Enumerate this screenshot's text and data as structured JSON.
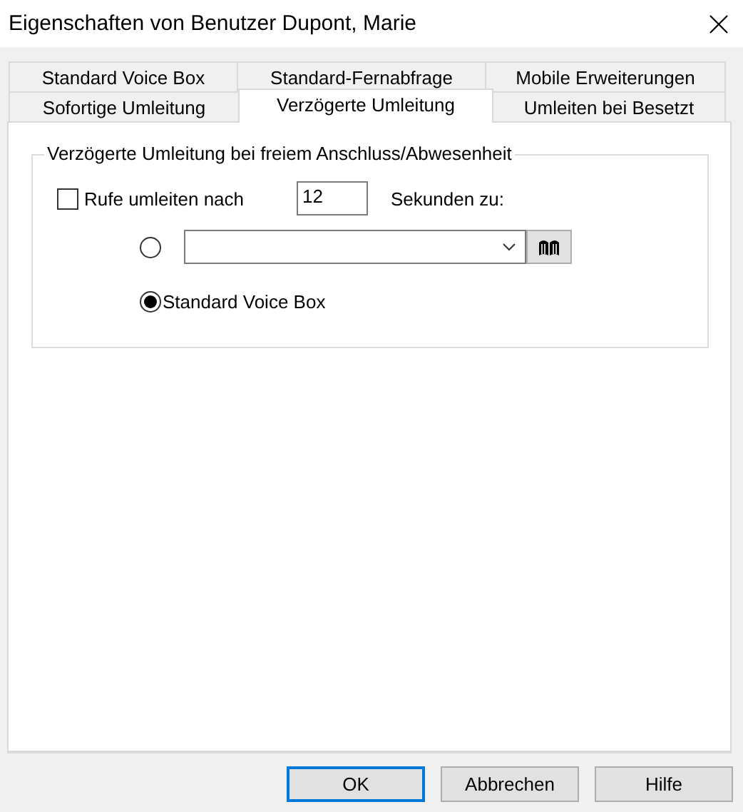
{
  "window": {
    "title": "Eigenschaften von Benutzer Dupont, Marie"
  },
  "tab_rows": [
    [
      {
        "label": "Standard Voice Box",
        "selected": false
      },
      {
        "label": "Standard-Fernabfrage",
        "selected": false
      },
      {
        "label": "Mobile Erweiterungen",
        "selected": false
      }
    ],
    [
      {
        "label": "Sofortige Umleitung",
        "selected": false
      },
      {
        "label": "Verzögerte Umleitung",
        "selected": true
      },
      {
        "label": "Umleiten bei Besetzt",
        "selected": false
      }
    ]
  ],
  "group": {
    "title": "Verzögerte Umleitung bei freiem Anschluss/Abwesenheit",
    "forward": {
      "label": "Rufe umleiten nach",
      "checked": false,
      "seconds": "12",
      "suffix": "Sekunden zu:"
    },
    "options": [
      {
        "kind": "combo",
        "selected": false
      },
      {
        "kind": "label",
        "label": "Standard Voice Box",
        "selected": true
      }
    ]
  },
  "buttons": [
    {
      "label": "OK",
      "default": true
    },
    {
      "label": "Abbrechen",
      "default": false
    },
    {
      "label": "Hilfe",
      "default": false
    }
  ]
}
